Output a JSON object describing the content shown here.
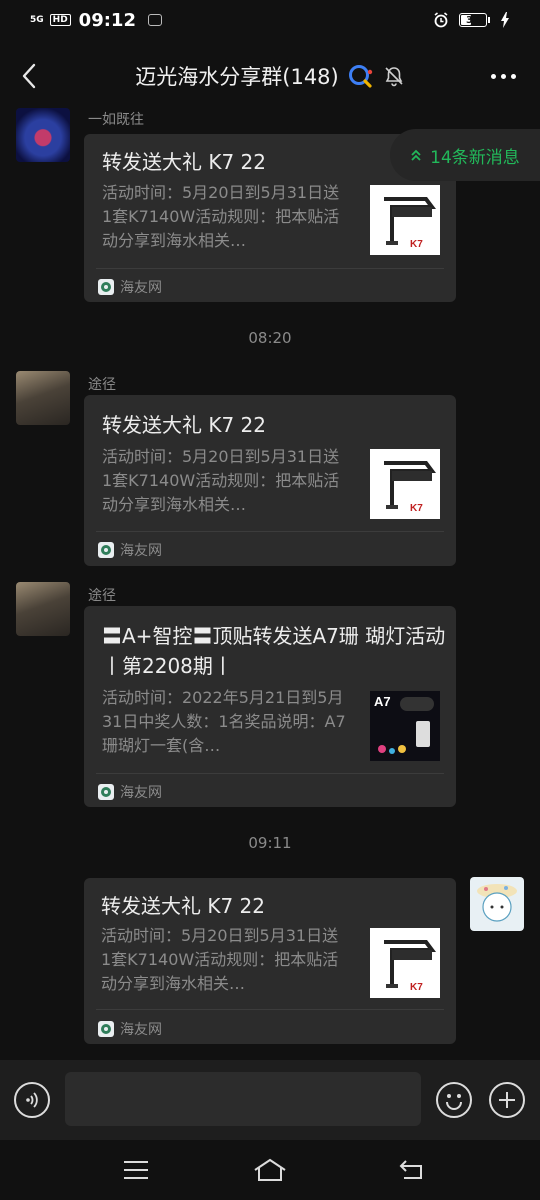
{
  "status_bar": {
    "network": "5G",
    "hd": "HD",
    "time": "09:12",
    "battery": "38"
  },
  "header": {
    "title": "迈光海水分享群(148)"
  },
  "new_messages": {
    "label": "14条新消息"
  },
  "messages": [
    {
      "sender": "一如既往",
      "title": "转发送大礼 K7 22",
      "desc": "活动时间：5月20日到5月31日送1套K7140W活动规则：把本贴活动分享到海水相关…",
      "source": "海友网"
    },
    {
      "timestamp": "08:20"
    },
    {
      "sender": "途径",
      "title": "转发送大礼 K7 22",
      "desc": "活动时间：5月20日到5月31日送1套K7140W活动规则：把本贴活动分享到海水相关…",
      "source": "海友网"
    },
    {
      "sender": "途径",
      "title": "〓A+智控〓顶贴转发送A7珊 瑚灯活动丨第2208期丨",
      "desc": "活动时间：2022年5月21日到5月31日中奖人数：1名奖品说明：A7珊瑚灯一套(含…",
      "source": "海友网",
      "thumb_label": "A7"
    },
    {
      "timestamp": "09:11"
    },
    {
      "self": true,
      "title": "转发送大礼 K7 22",
      "desc": "活动时间：5月20日到5月31日送1套K7140W活动规则：把本贴活动分享到海水相关…",
      "source": "海友网"
    }
  ],
  "colors": {
    "background": "#111111",
    "card": "#2c2c2c",
    "accent_green": "#22b85a"
  },
  "icons": [
    "back-icon",
    "search-icon",
    "mute-bell-icon",
    "more-icon",
    "voice-icon",
    "emoji-icon",
    "plus-icon",
    "menu-icon",
    "home-icon",
    "return-icon"
  ]
}
